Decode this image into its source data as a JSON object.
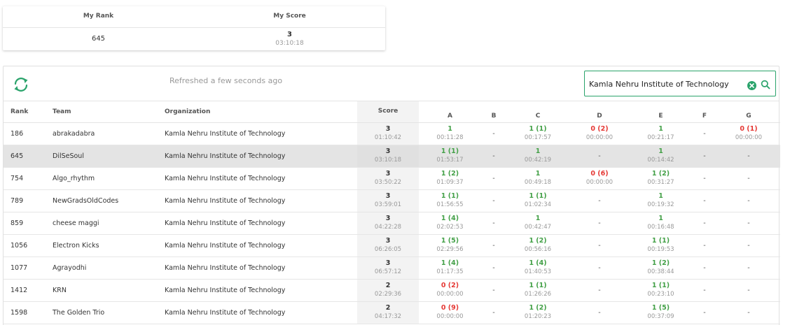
{
  "my_rank_card": {
    "rank_label": "My Rank",
    "score_label": "My Score",
    "rank": "645",
    "score": "3",
    "time": "03:10:18"
  },
  "toolbar": {
    "refresh_text": "Refreshed a few seconds ago",
    "search_value": "Kamla Nehru Institute of Technology",
    "icons": {
      "refresh": "refresh-icon",
      "clear": "clear-circle-icon",
      "search": "search-icon"
    }
  },
  "colors": {
    "accent": "#2aa36b",
    "solved": "#43a047",
    "failed": "#e53935",
    "highlight": "#e4e4e4"
  },
  "columns": {
    "rank": "Rank",
    "team": "Team",
    "organization": "Organization",
    "score": "Score",
    "problems": [
      "A",
      "B",
      "C",
      "D",
      "E",
      "F",
      "G"
    ]
  },
  "rows": [
    {
      "rank": "186",
      "team": "abrakadabra",
      "org": "Kamla Nehru Institute of Technology",
      "mine": false,
      "score": "3",
      "time": "01:10:42",
      "problems": [
        {
          "status": "ok",
          "v": "1",
          "t": "00:11:28"
        },
        {
          "status": "none",
          "v": "-"
        },
        {
          "status": "ok",
          "v": "1 (1)",
          "t": "00:17:57"
        },
        {
          "status": "bad",
          "v": "0 (2)",
          "t": "00:00:00"
        },
        {
          "status": "ok",
          "v": "1",
          "t": "00:21:17"
        },
        {
          "status": "none",
          "v": "-"
        },
        {
          "status": "bad",
          "v": "0 (1)",
          "t": "00:00:00"
        }
      ]
    },
    {
      "rank": "645",
      "team": "DilSeSoul",
      "org": "Kamla Nehru Institute of Technology",
      "mine": true,
      "score": "3",
      "time": "03:10:18",
      "problems": [
        {
          "status": "ok",
          "v": "1 (1)",
          "t": "01:53:17"
        },
        {
          "status": "none",
          "v": "-"
        },
        {
          "status": "ok",
          "v": "1",
          "t": "00:42:19"
        },
        {
          "status": "none",
          "v": "-"
        },
        {
          "status": "ok",
          "v": "1",
          "t": "00:14:42"
        },
        {
          "status": "none",
          "v": "-"
        },
        {
          "status": "none",
          "v": "-"
        }
      ]
    },
    {
      "rank": "754",
      "team": "Algo_rhythm",
      "org": "Kamla Nehru Institute of Technology",
      "mine": false,
      "score": "3",
      "time": "03:50:22",
      "problems": [
        {
          "status": "ok",
          "v": "1 (2)",
          "t": "01:09:37"
        },
        {
          "status": "none",
          "v": "-"
        },
        {
          "status": "ok",
          "v": "1",
          "t": "00:49:18"
        },
        {
          "status": "bad",
          "v": "0 (6)",
          "t": "00:00:00"
        },
        {
          "status": "ok",
          "v": "1 (2)",
          "t": "00:31:27"
        },
        {
          "status": "none",
          "v": "-"
        },
        {
          "status": "none",
          "v": "-"
        }
      ]
    },
    {
      "rank": "789",
      "team": "NewGradsOldCodes",
      "org": "Kamla Nehru Institute of Technology",
      "mine": false,
      "score": "3",
      "time": "03:59:01",
      "problems": [
        {
          "status": "ok",
          "v": "1 (1)",
          "t": "01:56:55"
        },
        {
          "status": "none",
          "v": "-"
        },
        {
          "status": "ok",
          "v": "1 (1)",
          "t": "01:02:34"
        },
        {
          "status": "none",
          "v": "-"
        },
        {
          "status": "ok",
          "v": "1",
          "t": "00:19:32"
        },
        {
          "status": "none",
          "v": "-"
        },
        {
          "status": "none",
          "v": "-"
        }
      ]
    },
    {
      "rank": "859",
      "team": "cheese maggi",
      "org": "Kamla Nehru Institute of Technology",
      "mine": false,
      "score": "3",
      "time": "04:22:28",
      "problems": [
        {
          "status": "ok",
          "v": "1 (4)",
          "t": "02:02:53"
        },
        {
          "status": "none",
          "v": "-"
        },
        {
          "status": "ok",
          "v": "1",
          "t": "00:42:47"
        },
        {
          "status": "none",
          "v": "-"
        },
        {
          "status": "ok",
          "v": "1",
          "t": "00:16:48"
        },
        {
          "status": "none",
          "v": "-"
        },
        {
          "status": "none",
          "v": "-"
        }
      ]
    },
    {
      "rank": "1056",
      "team": "Electron Kicks",
      "org": "Kamla Nehru Institute of Technology",
      "mine": false,
      "score": "3",
      "time": "06:26:05",
      "problems": [
        {
          "status": "ok",
          "v": "1 (5)",
          "t": "02:29:56"
        },
        {
          "status": "none",
          "v": "-"
        },
        {
          "status": "ok",
          "v": "1 (2)",
          "t": "00:56:16"
        },
        {
          "status": "none",
          "v": "-"
        },
        {
          "status": "ok",
          "v": "1 (1)",
          "t": "00:19:53"
        },
        {
          "status": "none",
          "v": "-"
        },
        {
          "status": "none",
          "v": "-"
        }
      ]
    },
    {
      "rank": "1077",
      "team": "Agrayodhi",
      "org": "Kamla Nehru Institute of Technology",
      "mine": false,
      "score": "3",
      "time": "06:57:12",
      "problems": [
        {
          "status": "ok",
          "v": "1 (4)",
          "t": "01:17:35"
        },
        {
          "status": "none",
          "v": "-"
        },
        {
          "status": "ok",
          "v": "1 (4)",
          "t": "01:40:53"
        },
        {
          "status": "none",
          "v": "-"
        },
        {
          "status": "ok",
          "v": "1 (2)",
          "t": "00:38:44"
        },
        {
          "status": "none",
          "v": "-"
        },
        {
          "status": "none",
          "v": "-"
        }
      ]
    },
    {
      "rank": "1412",
      "team": "KRN",
      "org": "Kamla Nehru Institute of Technology",
      "mine": false,
      "score": "2",
      "time": "02:29:36",
      "problems": [
        {
          "status": "bad",
          "v": "0 (2)",
          "t": "00:00:00"
        },
        {
          "status": "none",
          "v": "-"
        },
        {
          "status": "ok",
          "v": "1 (1)",
          "t": "01:26:26"
        },
        {
          "status": "none",
          "v": "-"
        },
        {
          "status": "ok",
          "v": "1 (1)",
          "t": "00:23:10"
        },
        {
          "status": "none",
          "v": "-"
        },
        {
          "status": "none",
          "v": "-"
        }
      ]
    },
    {
      "rank": "1598",
      "team": "The Golden Trio",
      "org": "Kamla Nehru Institute of Technology",
      "mine": false,
      "score": "2",
      "time": "04:17:32",
      "problems": [
        {
          "status": "bad",
          "v": "0 (9)",
          "t": "00:00:00"
        },
        {
          "status": "none",
          "v": "-"
        },
        {
          "status": "ok",
          "v": "1 (2)",
          "t": "01:20:23"
        },
        {
          "status": "none",
          "v": "-"
        },
        {
          "status": "ok",
          "v": "1 (5)",
          "t": "00:37:09"
        },
        {
          "status": "none",
          "v": "-"
        },
        {
          "status": "none",
          "v": "-"
        }
      ]
    }
  ]
}
